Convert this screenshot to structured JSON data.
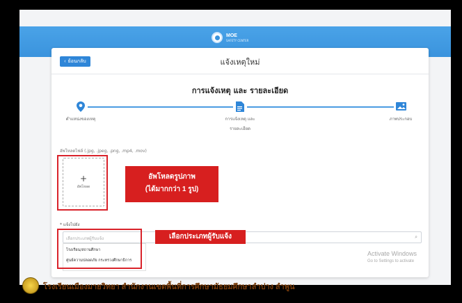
{
  "header": {
    "logo_text": "MOE",
    "logo_subtext": "SAFETY CENTER"
  },
  "card": {
    "back_label": "ย้อนกลับ",
    "title": "แจ้งเหตุใหม่",
    "section_title": "การแจ้งเหตุ และ รายละเอียด"
  },
  "steps": [
    {
      "label_line1": "ตำแหน่งของเหตุ",
      "label_line2": "",
      "icon": "map-pin-icon"
    },
    {
      "label_line1": "การแจ้งเหตุ และ",
      "label_line2": "รายละเอียด",
      "icon": "document-icon"
    },
    {
      "label_line1": "ภาพประกอบ",
      "label_line2": "",
      "icon": "image-icon"
    }
  ],
  "upload": {
    "hint": "อัพโหลดไฟล์ (.jpg, .jpeg, .png, .mp4, .mov)",
    "plus": "+",
    "button_label": "อัพโหลด"
  },
  "annotations": {
    "upload_line1": "อัพโหลดรูปภาพ",
    "upload_line2": "(ได้มากกว่า 1 รูป)",
    "recipient": "เลือกประเภทผู้รับแจ้ง"
  },
  "recipient": {
    "label": "* แจ้งไปยัง",
    "placeholder": "เลือกประเภทผู้รับแจ้ง",
    "options": [
      "โรงเรียน/สถานศึกษา",
      "ศูนย์ความปลอดภัย กระทรวงศึกษาธิการ"
    ]
  },
  "watermark": {
    "line1": "Activate Windows",
    "line2": "Go to Settings to activate"
  },
  "banner": {
    "text": "โรงเรียนเมืองมายวิทยา  สำนักงานเขตพื้นที่การศึกษามัธยมศึกษาลำปาง  ลำพูน"
  },
  "colors": {
    "primary": "#3a93dd",
    "accent_red": "#d71f1f"
  }
}
